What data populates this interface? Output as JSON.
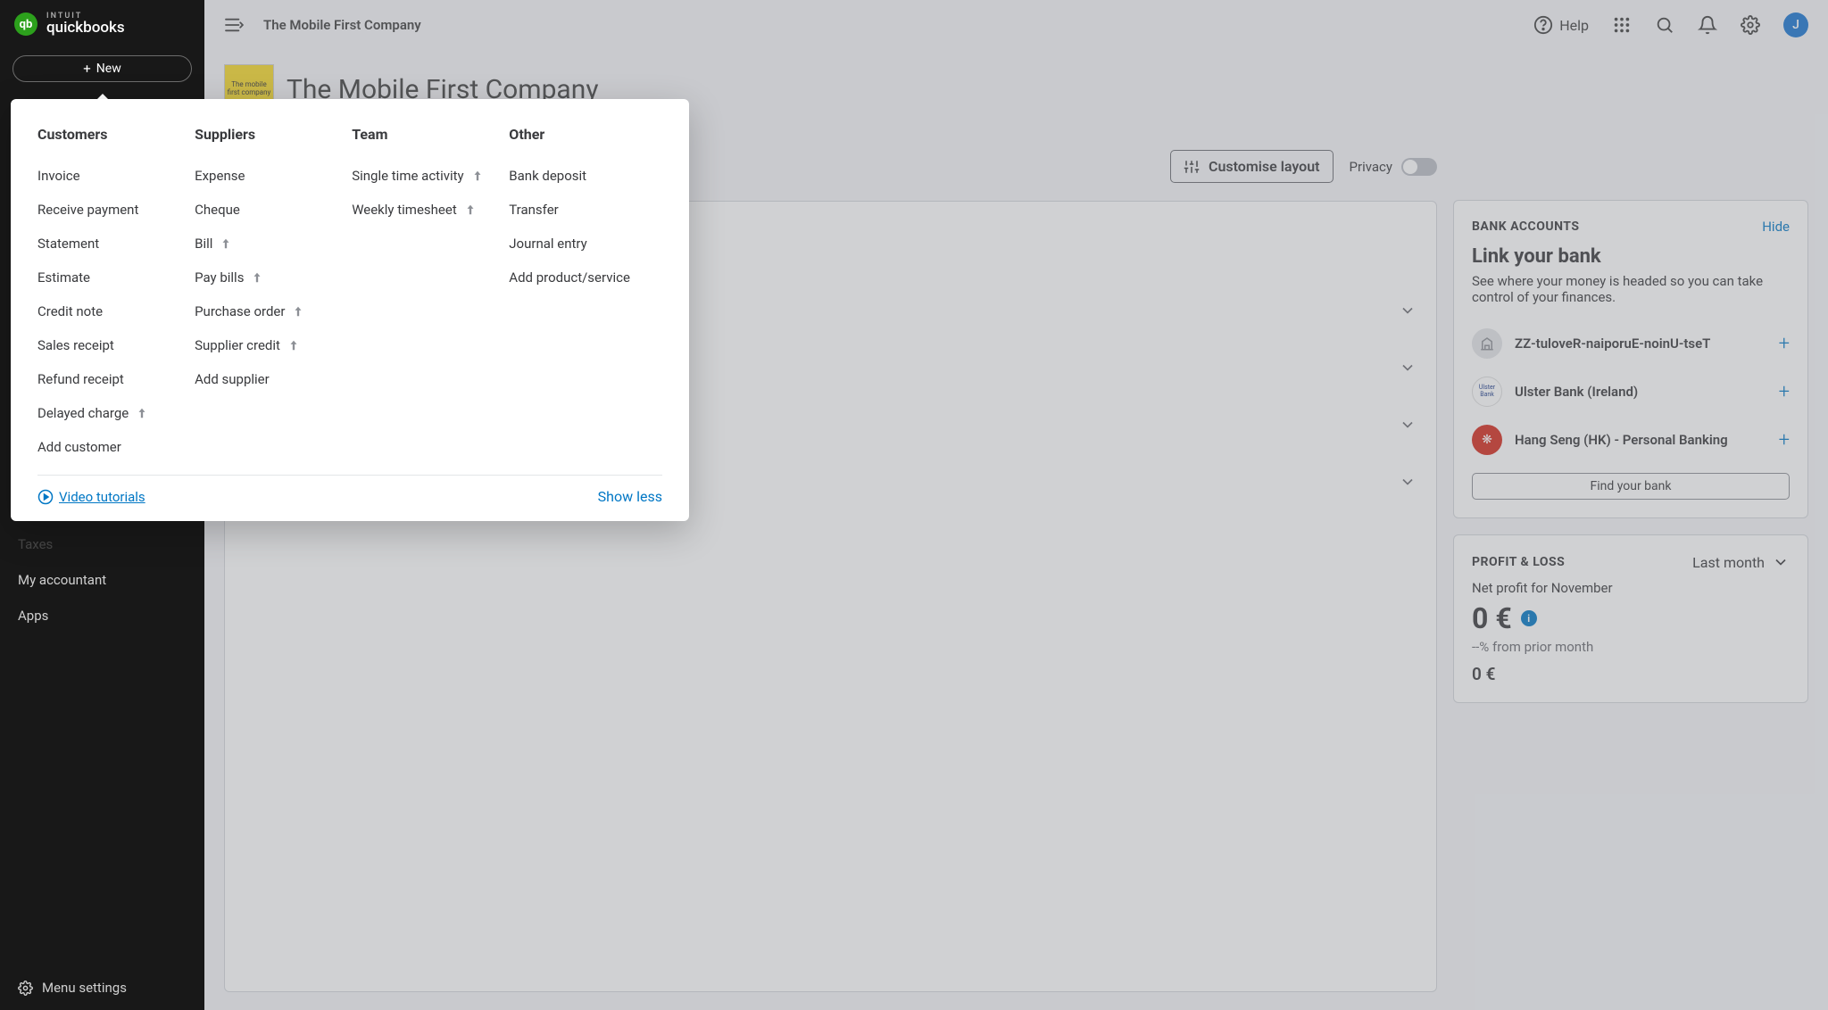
{
  "brand": {
    "intuit": "INTUIT",
    "name": "quickbooks",
    "logo_text": "qb"
  },
  "new_button": "New",
  "sidebar": {
    "items": [
      "Taxes",
      "My accountant",
      "Apps"
    ],
    "menu_settings": "Menu settings"
  },
  "topbar": {
    "company": "The Mobile First Company",
    "help": "Help",
    "avatar": "J"
  },
  "page": {
    "company_name": "The Mobile First Company",
    "logo_alt": "The mobile first company"
  },
  "layout_bar": {
    "customise": "Customise layout",
    "privacy": "Privacy",
    "privacy_on": false
  },
  "panels": [
    "",
    "",
    "",
    ""
  ],
  "bank_card": {
    "title": "BANK ACCOUNTS",
    "hide": "Hide",
    "heading": "Link your bank",
    "desc": "See where your money is headed so you can take control of your finances.",
    "banks": [
      {
        "name": "ZZ-tuloveR-naiporuE-noinU-tseT",
        "style": "grey"
      },
      {
        "name": "Ulster Bank (Ireland)",
        "style": "ulster"
      },
      {
        "name": "Hang Seng (HK) - Personal Banking",
        "style": "red"
      }
    ],
    "find": "Find your bank"
  },
  "pl_card": {
    "title": "PROFIT & LOSS",
    "period": "Last month",
    "sub": "Net profit for November",
    "value": "0 €",
    "change": "--% from prior month",
    "bottom": "0 €"
  },
  "new_menu": {
    "columns": [
      {
        "title": "Customers",
        "items": [
          {
            "label": "Invoice",
            "upgrade": false
          },
          {
            "label": "Receive payment",
            "upgrade": false
          },
          {
            "label": "Statement",
            "upgrade": false
          },
          {
            "label": "Estimate",
            "upgrade": false
          },
          {
            "label": "Credit note",
            "upgrade": false
          },
          {
            "label": "Sales receipt",
            "upgrade": false
          },
          {
            "label": "Refund receipt",
            "upgrade": false
          },
          {
            "label": "Delayed charge",
            "upgrade": true
          },
          {
            "label": "Add customer",
            "upgrade": false
          }
        ]
      },
      {
        "title": "Suppliers",
        "items": [
          {
            "label": "Expense",
            "upgrade": false
          },
          {
            "label": "Cheque",
            "upgrade": false
          },
          {
            "label": "Bill",
            "upgrade": true
          },
          {
            "label": "Pay bills",
            "upgrade": true
          },
          {
            "label": "Purchase order",
            "upgrade": true
          },
          {
            "label": "Supplier credit",
            "upgrade": true
          },
          {
            "label": "Add supplier",
            "upgrade": false
          }
        ]
      },
      {
        "title": "Team",
        "items": [
          {
            "label": "Single time activity",
            "upgrade": true
          },
          {
            "label": "Weekly timesheet",
            "upgrade": true
          }
        ]
      },
      {
        "title": "Other",
        "items": [
          {
            "label": "Bank deposit",
            "upgrade": false
          },
          {
            "label": "Transfer",
            "upgrade": false
          },
          {
            "label": "Journal entry",
            "upgrade": false
          },
          {
            "label": "Add product/service",
            "upgrade": false
          }
        ]
      }
    ],
    "video": "Video tutorials",
    "show_less": "Show less"
  }
}
